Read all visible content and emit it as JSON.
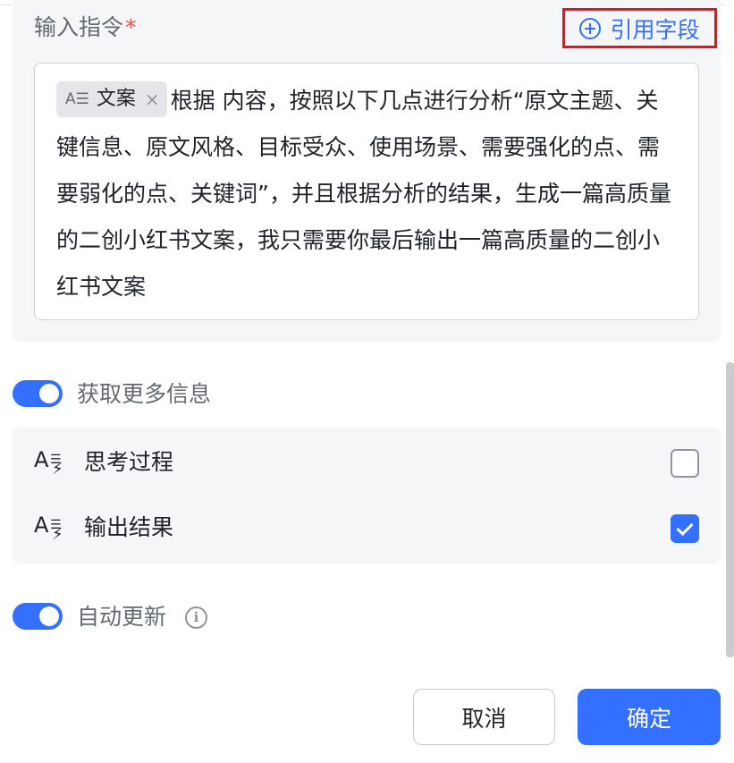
{
  "instruction": {
    "label": "输入指令",
    "required_mark": "*",
    "ref_field_button": "引用字段",
    "chip": {
      "icon": "A☰",
      "label": "文案",
      "close": "×"
    },
    "text": "根据 内容，按照以下几点进行分析“原文主题、关键信息、原文风格、目标受众、使用场景、需要强化的点、需要弱化的点、关键词”，并且根据分析的结果，生成一篇高质量的二创小红书文案，我只需要你最后输出一篇高质量的二创小红书文案"
  },
  "more_info": {
    "toggle_label": "获取更多信息",
    "toggle_on": true,
    "options": [
      {
        "label": "思考过程",
        "checked": false
      },
      {
        "label": "输出结果",
        "checked": true
      }
    ]
  },
  "auto_update": {
    "toggle_label": "自动更新",
    "toggle_on": true,
    "info_icon": "i"
  },
  "footer": {
    "cancel_label": "取消",
    "confirm_label": "确定"
  },
  "colors": {
    "accent": "#3370ff",
    "highlight_border": "#f0101a",
    "required": "#f54a45",
    "panel_bg": "#f5f6f7"
  }
}
